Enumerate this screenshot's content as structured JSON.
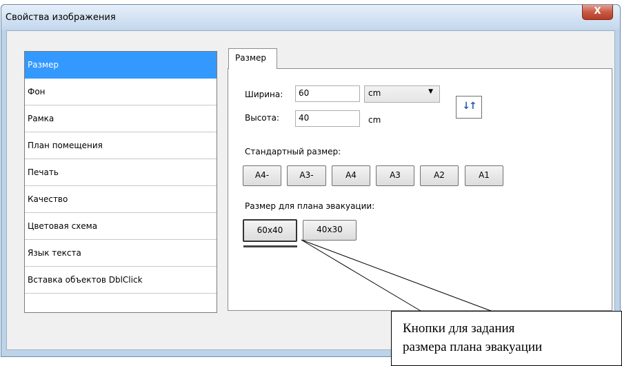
{
  "window": {
    "title": "Свойства изображения",
    "close_label": "X"
  },
  "sidebar": {
    "items": [
      {
        "label": "Размер",
        "selected": true
      },
      {
        "label": "Фон"
      },
      {
        "label": "Рамка"
      },
      {
        "label": "План помещения"
      },
      {
        "label": "Печать"
      },
      {
        "label": "Качество"
      },
      {
        "label": "Цветовая схема"
      },
      {
        "label": "Язык текста"
      },
      {
        "label": "Вставка объектов DblClick"
      }
    ]
  },
  "tab": {
    "label": "Размер"
  },
  "size": {
    "width_label": "Ширина:",
    "width_value": "60",
    "height_label": "Высота:",
    "height_value": "40",
    "unit_selected": "cm",
    "height_unit": "cm",
    "swap_icon": "swap-arrows-icon",
    "swap_glyph": "↓↑"
  },
  "standard": {
    "label": "Стандартный размер:",
    "buttons": [
      "A4-",
      "A3-",
      "A4",
      "A3",
      "A2",
      "A1"
    ]
  },
  "evacuation": {
    "label": "Размер для плана эвакуации:",
    "buttons": [
      "60x40",
      "40x30"
    ]
  },
  "callout": {
    "line1": "Кнопки для задания",
    "line2": "размера плана эвакуации"
  },
  "colors": {
    "selection": "#3399ff",
    "window_frame": "#bcd3ea",
    "close": "#c75a45"
  }
}
